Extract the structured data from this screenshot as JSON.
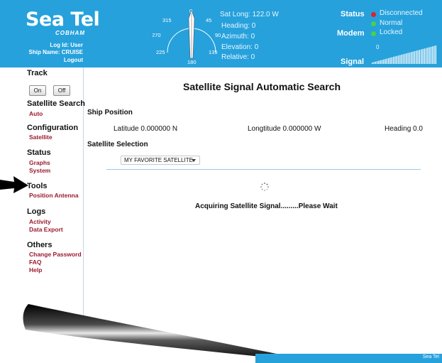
{
  "header": {
    "logo": "Sea Tel",
    "sublogo": "COBHAM",
    "log_id": "Log Id: User",
    "ship_name": "Ship Name: CRUISE",
    "logout": "Logout"
  },
  "compass": {
    "labels": {
      "n": "0",
      "ne": "45",
      "e": "90",
      "se": "135",
      "s": "180",
      "sw": "225",
      "w": "270",
      "nw": "315"
    }
  },
  "readouts": {
    "sat_long": "Sat Long: 122.0 W",
    "heading": "Heading: 0",
    "azimuth": "Azimuth: 0",
    "elevation": "Elevation: 0",
    "relative": "Relative: 0"
  },
  "status": {
    "status_label": "Status",
    "status_value": "Disconnected",
    "status_color": "#d9232f",
    "normal_value": "Normal",
    "normal_color": "#44d444",
    "modem_label": "Modem",
    "modem_value": "Locked",
    "modem_color": "#44d444",
    "signal_label": "Signal",
    "signal_value": "0"
  },
  "sidebar": {
    "track": {
      "heading": "Track",
      "on": "On",
      "off": "Off"
    },
    "satellite_search": {
      "heading": "Satellite Search",
      "items": [
        "Auto"
      ]
    },
    "configuration": {
      "heading": "Configuration",
      "items": [
        "Satellite"
      ]
    },
    "status": {
      "heading": "Status",
      "items": [
        "Graphs",
        "System"
      ]
    },
    "tools": {
      "heading": "Tools",
      "items": [
        "Position Antenna"
      ]
    },
    "logs": {
      "heading": "Logs",
      "items": [
        "Activity",
        "Data Export"
      ]
    },
    "others": {
      "heading": "Others",
      "items": [
        "Change Password",
        "FAQ",
        "Help"
      ]
    }
  },
  "main": {
    "title": "Satellite Signal Automatic Search",
    "ship_position": {
      "heading": "Ship Position",
      "latitude": "Latitude 0.000000 N",
      "longitude": "Longtitude 0.000000 W",
      "heading_value": "Heading 0.0"
    },
    "satellite_selection": {
      "heading": "Satellite Selection",
      "selected": "MY FAVORITE SATELLITE"
    },
    "acquiring": "Acquiring Satellite Signal.........Please Wait"
  },
  "footer": {
    "text": "Sea Tel"
  },
  "colors": {
    "header_bg": "#26a1dc",
    "link": "#9a1b2e"
  }
}
